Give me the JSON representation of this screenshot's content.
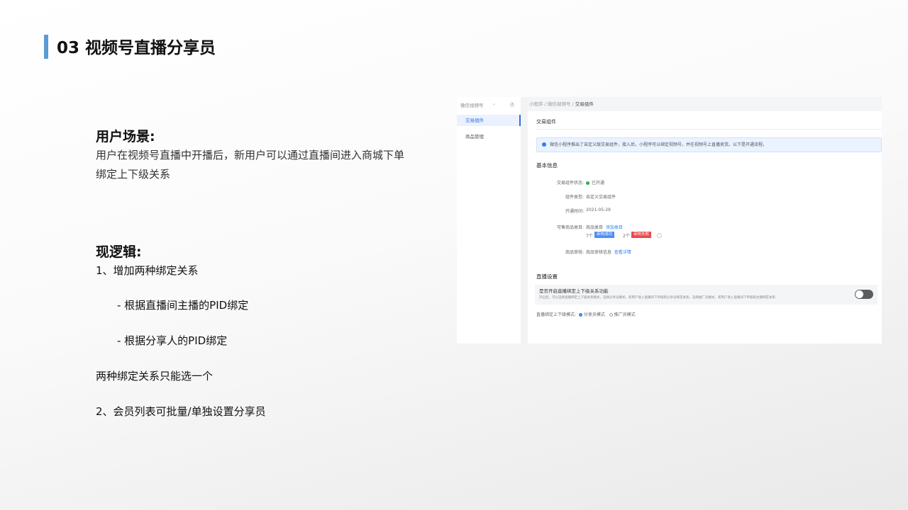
{
  "page": {
    "title": "03 视频号直播分享员"
  },
  "scenario": {
    "heading": "用户场景:",
    "text_line1": "用户在视频号直播中开播后，新用户可以通过直播间进入商城下单",
    "text_line2": "绑定上下级关系"
  },
  "logic": {
    "heading": "现逻辑:",
    "lines": [
      "1、增加两种绑定关系",
      "- 根据直播间主播的PID绑定",
      "- 根据分享人的PID绑定",
      "两种绑定关系只能选一个",
      "2、会员列表可批量/单独设置分享员"
    ]
  },
  "screenshot": {
    "sidebar": {
      "header": "微信视频号",
      "header_badge": "2",
      "items": [
        "交易组件",
        "商品管理"
      ]
    },
    "breadcrumb": {
      "part1": "小程序",
      "sep": "/",
      "part2": "微信视频号",
      "current": "交易组件"
    },
    "section_title": "交易组件",
    "notice": "微信小程序推出了自定义版交易组件，接入后，小程序可以绑定视频号，并在视频号上直播卖货。以下是开通流程。",
    "basic": {
      "heading": "基本信息",
      "status_label": "交易组件状态:",
      "status_value": "已开通",
      "type_label": "组件类型:",
      "type_value": "自定义交易组件",
      "time_label": "开通时间:",
      "time_value": "2021-05-29",
      "category_label": "可售商品类目:",
      "category_value": "商品类目",
      "category_add": "添加类目",
      "count_ok": "7个",
      "tag_ok": "审核成功",
      "count_fail": "2个",
      "tag_fail": "审核失败",
      "audit_label": "商品审核:",
      "audit_value": "商品审核信息",
      "audit_link": "查看详情"
    },
    "live": {
      "heading": "直播设置",
      "switch_title": "是否开启直播绑定上下级关系功能",
      "switch_desc": "开启后，可以选择直播绑定上下级关系模式，选择分享员模式，新用户进入直播间下单按照分享员绑定关系，选择推广员模式，新用户进入直播间下单按照主播绑定关系",
      "mode_label": "直播绑定上下级模式:",
      "mode_option1": "分享员模式",
      "mode_option2": "推广员模式"
    }
  }
}
